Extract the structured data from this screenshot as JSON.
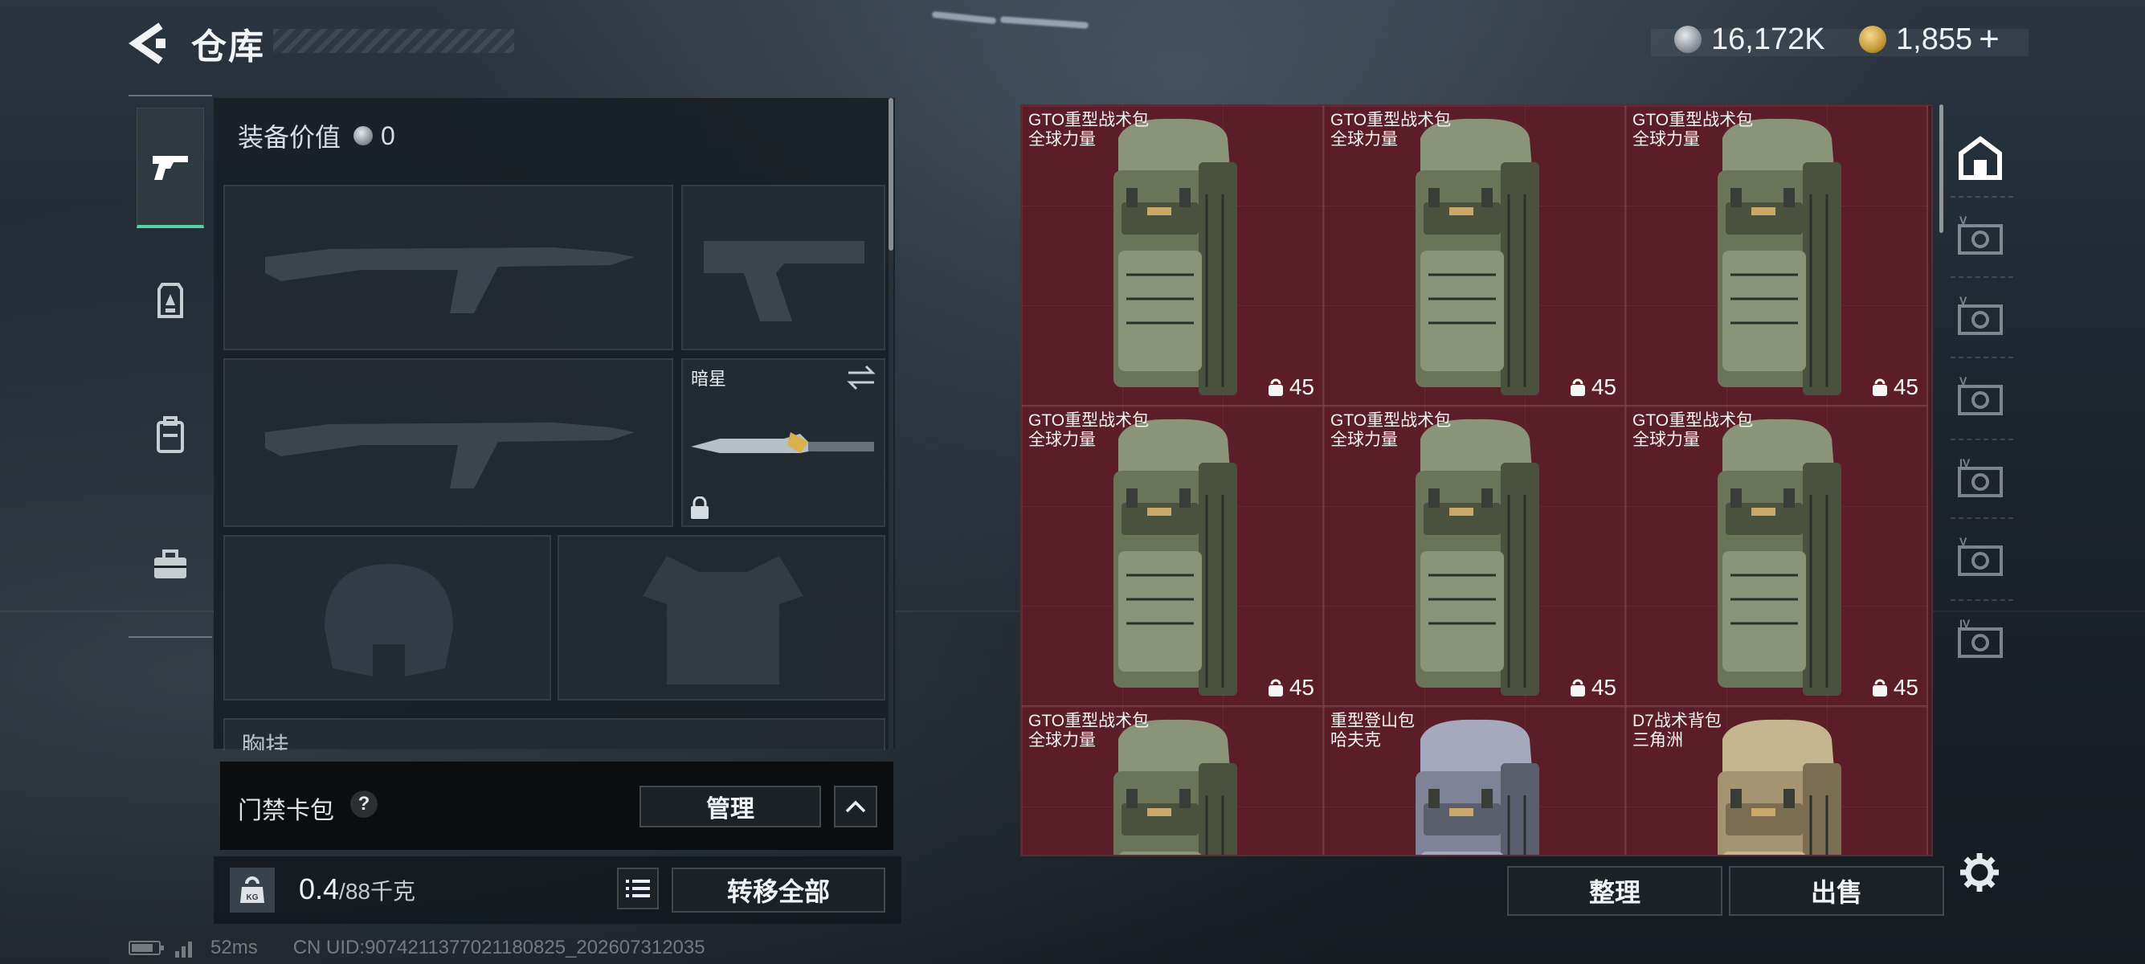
{
  "header": {
    "title": "仓库",
    "back_icon": "back-arrow-icon",
    "currency_silver": "16,172K",
    "currency_gold": "1,855",
    "currency_plus": "+"
  },
  "tabs": [
    {
      "icon": "pistol-icon",
      "active": true
    },
    {
      "icon": "armor-icon",
      "active": false
    },
    {
      "icon": "backpack-icon",
      "active": false
    },
    {
      "icon": "toolbox-icon",
      "active": false
    }
  ],
  "loadout": {
    "equip_value_label": "装备价值",
    "equip_value": "0",
    "melee_slot_name": "暗星",
    "chest_label": "胸挂"
  },
  "keycard": {
    "title": "门禁卡包",
    "help": "?",
    "manage_label": "管理"
  },
  "weight": {
    "current": "0.4",
    "max": "/88千克",
    "transfer_all_label": "转移全部"
  },
  "storage": {
    "items": [
      {
        "name": "GTO重型战术包",
        "brand": "全球力量",
        "capacity": "45",
        "color": "green"
      },
      {
        "name": "GTO重型战术包",
        "brand": "全球力量",
        "capacity": "45",
        "color": "green"
      },
      {
        "name": "GTO重型战术包",
        "brand": "全球力量",
        "capacity": "45",
        "color": "green"
      },
      {
        "name": "GTO重型战术包",
        "brand": "全球力量",
        "capacity": "45",
        "color": "green"
      },
      {
        "name": "GTO重型战术包",
        "brand": "全球力量",
        "capacity": "45",
        "color": "green"
      },
      {
        "name": "GTO重型战术包",
        "brand": "全球力量",
        "capacity": "45",
        "color": "green"
      },
      {
        "name": "GTO重型战术包",
        "brand": "全球力量",
        "capacity": "",
        "color": "green"
      },
      {
        "name": "重型登山包",
        "brand": "哈夫克",
        "capacity": "",
        "color": "grey"
      },
      {
        "name": "D7战术背包",
        "brand": "三角洲",
        "capacity": "",
        "color": "tan"
      }
    ],
    "sort_label": "整理",
    "sell_label": "出售"
  },
  "storage_tabs": [
    {
      "icon": "storage-home-icon"
    },
    {
      "icon": "storage-v-icon"
    },
    {
      "icon": "storage-v-icon"
    },
    {
      "icon": "storage-v-icon"
    },
    {
      "icon": "storage-iv-icon"
    },
    {
      "icon": "storage-v-icon"
    },
    {
      "icon": "storage-iv-icon"
    }
  ],
  "footer": {
    "ping": "52ms",
    "uid": "CN UID:9074211377021180825_202607312035"
  },
  "colors": {
    "accent": "#4fd6a2",
    "grid_bg": "#5b1e29"
  }
}
